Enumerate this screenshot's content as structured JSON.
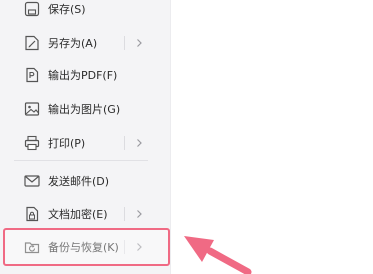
{
  "menu": {
    "items": [
      {
        "label": "保存(S)",
        "icon": "save-icon",
        "has_submenu": false
      },
      {
        "label": "另存为(A)",
        "icon": "save-as-icon",
        "has_submenu": true
      },
      {
        "label": "输出为PDF(F)",
        "icon": "pdf-icon",
        "has_submenu": false
      },
      {
        "label": "输出为图片(G)",
        "icon": "image-icon",
        "has_submenu": false
      },
      {
        "label": "打印(P)",
        "icon": "printer-icon",
        "has_submenu": true
      },
      {
        "label": "发送邮件(D)",
        "icon": "mail-icon",
        "has_submenu": false
      },
      {
        "label": "文档加密(E)",
        "icon": "document-lock-icon",
        "has_submenu": true
      },
      {
        "label": "备份与恢复(K)",
        "icon": "backup-restore-icon",
        "has_submenu": true
      }
    ]
  },
  "annotation": {
    "highlight_color": "#f06a84",
    "highlighted_item": "备份与恢复(K)"
  }
}
